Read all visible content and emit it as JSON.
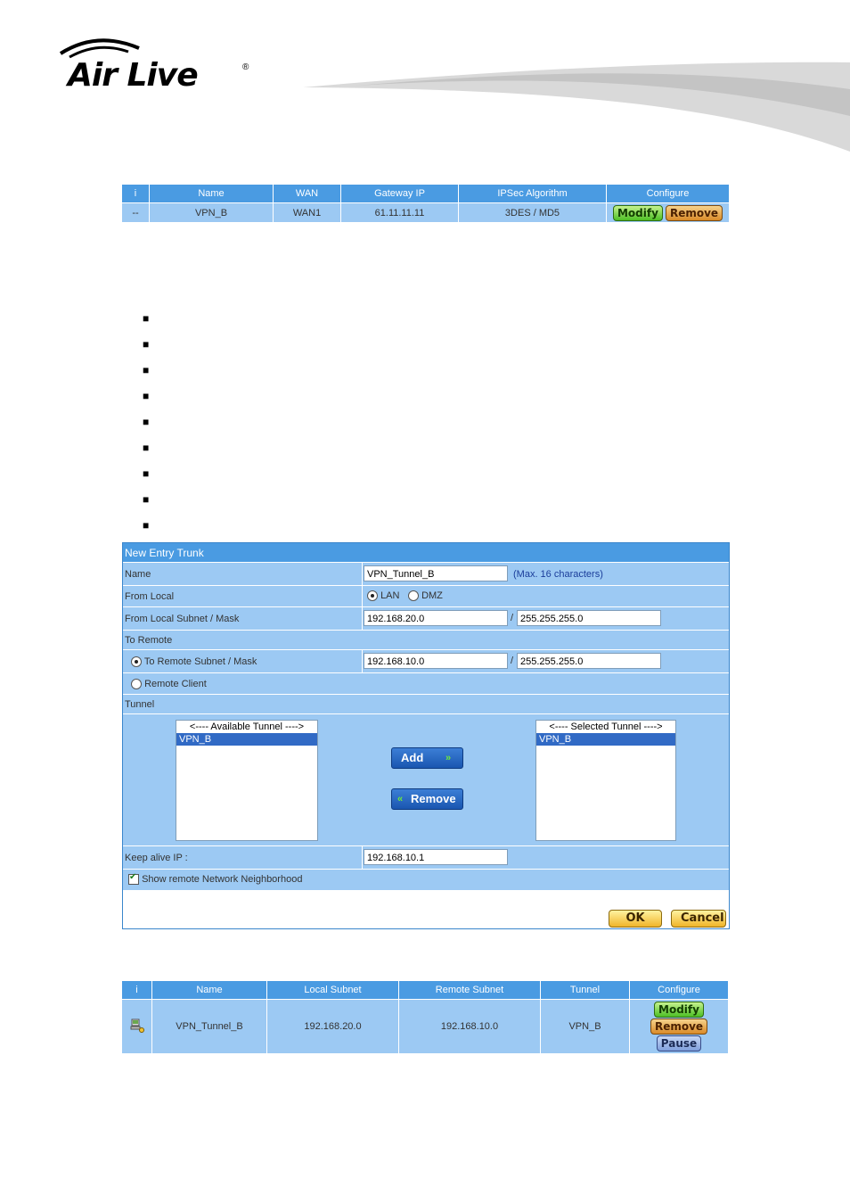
{
  "brand": {
    "logo_text": "Air Live",
    "registered": "®"
  },
  "vpn_table": {
    "headers": [
      "i",
      "Name",
      "WAN",
      "Gateway IP",
      "IPSec Algorithm",
      "Configure"
    ],
    "row": {
      "i": "--",
      "name": "VPN_B",
      "wan": "WAN1",
      "gateway_ip": "61.11.11.11",
      "algorithm": "3DES / MD5"
    },
    "modify_label": "Modify",
    "remove_label": "Remove"
  },
  "bullets": [
    "■",
    "■",
    "■",
    "■",
    "■",
    "■",
    "■",
    "■",
    "■"
  ],
  "form": {
    "title": "New Entry Trunk",
    "name_label": "Name",
    "name_value": "VPN_Tunnel_B",
    "name_hint": "(Max. 16 characters)",
    "from_local_label": "From Local",
    "lan_label": "LAN",
    "dmz_label": "DMZ",
    "local_subnet_label": "From Local Subnet / Mask",
    "local_subnet": "192.168.20.0",
    "local_mask": "255.255.255.0",
    "slash": "/",
    "to_remote_label": "To Remote",
    "remote_subnet_label": "To Remote Subnet / Mask",
    "remote_subnet": "192.168.10.0",
    "remote_mask": "255.255.255.0",
    "remote_client_label": "Remote Client",
    "tunnel_label": "Tunnel",
    "available_header": "<---- Available Tunnel ---->",
    "available_item": "VPN_B",
    "selected_header": "<---- Selected Tunnel ---->",
    "selected_item": "VPN_B",
    "add_label": "Add",
    "remove_label": "Remove",
    "keepalive_label": "Keep alive IP :",
    "keepalive_value": "192.168.10.1",
    "show_neighborhood_label": "Show remote Network Neighborhood",
    "ok_label": "OK",
    "cancel_label": "Cancel"
  },
  "trunk_table": {
    "headers": [
      "i",
      "Name",
      "Local Subnet",
      "Remote Subnet",
      "Tunnel",
      "Configure"
    ],
    "row": {
      "name": "VPN_Tunnel_B",
      "local_subnet": "192.168.20.0",
      "remote_subnet": "192.168.10.0",
      "tunnel": "VPN_B"
    },
    "modify_label": "Modify",
    "remove_label": "Remove",
    "pause_label": "Pause"
  },
  "colors": {
    "header_blue": "#4a9be2",
    "row_blue": "#9cc9f3"
  }
}
